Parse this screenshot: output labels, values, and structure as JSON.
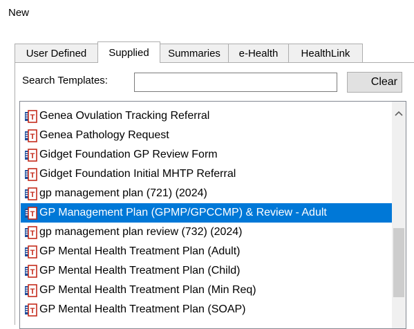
{
  "window": {
    "title": "New"
  },
  "tabs": [
    {
      "label": "User Defined",
      "active": false
    },
    {
      "label": "Supplied",
      "active": true
    },
    {
      "label": "Summaries",
      "active": false
    },
    {
      "label": "e-Health",
      "active": false
    },
    {
      "label": "HealthLink",
      "active": false
    }
  ],
  "search": {
    "label": "Search Templates:",
    "value": "",
    "clear_label": "Clear"
  },
  "templates": {
    "selected_index": 5,
    "items": [
      {
        "label": "Genea Ovulation Tracking Referral",
        "icon": "template-document-icon"
      },
      {
        "label": "Genea Pathology Request",
        "icon": "template-document-icon"
      },
      {
        "label": "Gidget Foundation GP Review Form",
        "icon": "template-document-icon"
      },
      {
        "label": "Gidget Foundation Initial MHTP Referral",
        "icon": "template-document-icon"
      },
      {
        "label": "gp management plan (721) (2024)",
        "icon": "template-document-icon"
      },
      {
        "label": "GP Management Plan (GPMP/GPCCMP) & Review - Adult",
        "icon": "template-document-icon"
      },
      {
        "label": "gp management plan review (732) (2024)",
        "icon": "template-document-icon"
      },
      {
        "label": "GP Mental Health Treatment Plan (Adult)",
        "icon": "template-document-icon"
      },
      {
        "label": "GP Mental Health Treatment Plan (Child)",
        "icon": "template-document-icon"
      },
      {
        "label": "GP Mental Health Treatment Plan (Min Req)",
        "icon": "template-document-icon"
      },
      {
        "label": "GP Mental Health Treatment Plan (SOAP)",
        "icon": "template-document-icon"
      }
    ]
  },
  "scrollbar": {
    "up_icon": "chevron-up-icon",
    "position_fraction": 0.55
  },
  "colors": {
    "selection": "#0078d7",
    "icon_red": "#c42b1c",
    "icon_blue": "#1f4e9c"
  }
}
